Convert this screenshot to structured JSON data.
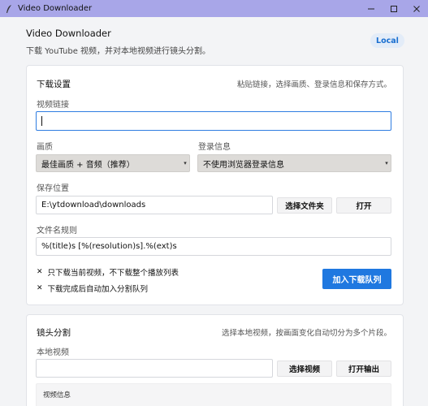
{
  "window": {
    "title": "Video Downloader",
    "controls": [
      "minimize",
      "maximize",
      "close"
    ]
  },
  "header": {
    "title": "Video Downloader",
    "subtitle": "下载 YouTube 视频，并对本地视频进行镜头分割。",
    "badge": "Local"
  },
  "download": {
    "title": "下载设置",
    "hint": "粘贴链接，选择画质、登录信息和保存方式。",
    "url_label": "视频链接",
    "url_value": "",
    "quality_label": "画质",
    "quality_value": "最佳画质 + 音频（推荐）",
    "login_label": "登录信息",
    "login_value": "不使用浏览器登录信息",
    "save_label": "保存位置",
    "save_value": "E:\\ytdownload\\downloads",
    "choose_folder": "选择文件夹",
    "open": "打开",
    "filename_label": "文件名规则",
    "filename_value": "%(title)s [%(resolution)s].%(ext)s",
    "option1": "只下载当前视频，不下载整个播放列表",
    "option2": "下载完成后自动加入分割队列",
    "add_queue": "加入下载队列"
  },
  "split": {
    "title": "镜头分割",
    "hint": "选择本地视频，按画面变化自动切分为多个片段。",
    "local_label": "本地视频",
    "local_value": "",
    "choose_video": "选择视频",
    "open_output": "打开输出",
    "info_label": "视频信息"
  }
}
